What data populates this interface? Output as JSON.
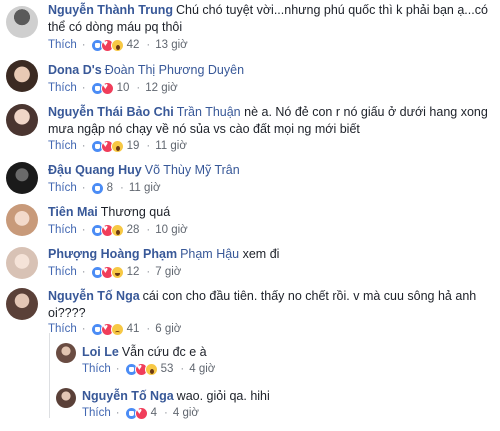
{
  "like_label": "Thích",
  "comments": [
    {
      "author": "Nguyễn Thành Trung",
      "tag": "",
      "text": "Chú chó tuyệt vời...nhưng phú quốc thì k phải bạn ạ...có thể có dòng máu pq thôi",
      "reactions": [
        "like",
        "love",
        "wow"
      ],
      "count": "42",
      "time": "13 giờ"
    },
    {
      "author": "Dona D's",
      "tag": "Đoàn Thị Phương Duyên",
      "text": "",
      "reactions": [
        "like",
        "love"
      ],
      "count": "10",
      "time": "12 giờ"
    },
    {
      "author": "Nguyễn Thái Bảo Chi",
      "tag": "Trần Thuận",
      "text": "nè a. Nó đẻ con r nó giấu ở dưới hang xong mưa ngập nó chạy về nó sủa vs cào đất mọi ng mới biết",
      "reactions": [
        "like",
        "love",
        "wow"
      ],
      "count": "19",
      "time": "11 giờ"
    },
    {
      "author": "Đậu Quang Huy",
      "tag": "Võ Thùy Mỹ Trân",
      "text": "",
      "reactions": [
        "like"
      ],
      "count": "8",
      "time": "11 giờ"
    },
    {
      "author": "Tiên Mai",
      "tag": "",
      "text": "Thương quá",
      "reactions": [
        "like",
        "love",
        "wow"
      ],
      "count": "28",
      "time": "10 giờ"
    },
    {
      "author": "Phượng Hoàng Phạm",
      "tag": "Phạm Hậu",
      "text": "xem đi",
      "reactions": [
        "like",
        "love",
        "haha"
      ],
      "count": "12",
      "time": "7 giờ"
    },
    {
      "author": "Nguyễn Tố Nga",
      "tag": "",
      "text": "cái con cho đầu tiên. thấy no chết rồi. v mà cuu sông hả anh oi????",
      "reactions": [
        "like",
        "love",
        "sad"
      ],
      "count": "41",
      "time": "6 giờ"
    },
    {
      "author": "Loi Le",
      "tag": "",
      "text": "Vẫn cứu đc e à",
      "reactions": [
        "like",
        "love",
        "wow"
      ],
      "count": "53",
      "time": "4 giờ"
    },
    {
      "author": "Nguyễn Tố Nga",
      "tag": "",
      "text": "wao. giỏi qa. hihi",
      "reactions": [
        "like",
        "love"
      ],
      "count": "4",
      "time": "4 giờ"
    }
  ],
  "colors": {
    "link": "#385898",
    "text": "#1d2129",
    "meta": "#616770",
    "like": "#4267b2"
  }
}
